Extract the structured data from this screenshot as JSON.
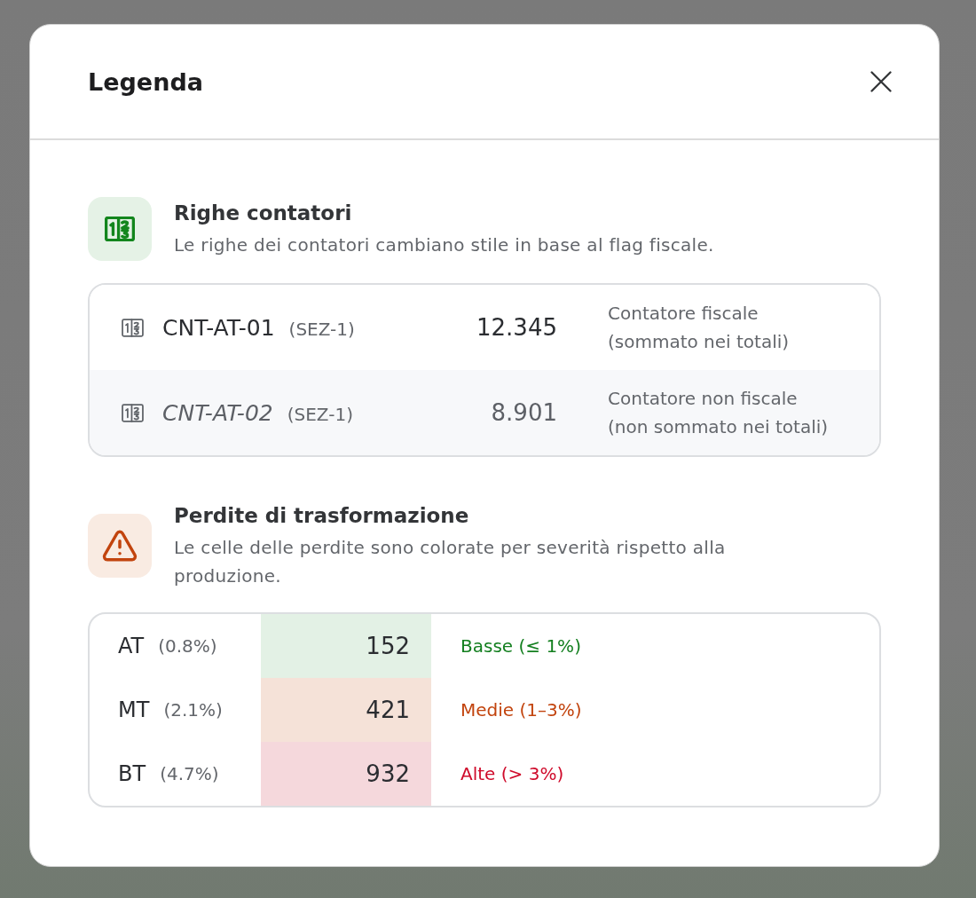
{
  "dialog": {
    "title": "Legenda"
  },
  "sections": [
    {
      "kind": "meters",
      "title": "Righe contatori",
      "description": "Le righe dei contatori cambiano stile in base al flag fiscale.",
      "rows": [
        {
          "code": "CNT-AT-01",
          "section": "(SEZ-1)",
          "reading": "12.345",
          "fiscal": true,
          "description": "Contatore fiscale",
          "note": "(sommato nei totali)"
        },
        {
          "code": "CNT-AT-02",
          "section": "(SEZ-1)",
          "reading": "8.901",
          "fiscal": false,
          "description": "Contatore non fiscale",
          "note": "(non sommato nei totali)"
        }
      ]
    },
    {
      "kind": "losses",
      "title": "Perdite di trasformazione",
      "description": "Le celle delle perdite sono colorate per severità rispetto alla produzione.",
      "rows": [
        {
          "kind": "low",
          "voltage": "AT",
          "share": "(0.8%)",
          "loss": "152",
          "severity_label": "Basse (≤ 1%)"
        },
        {
          "kind": "medium",
          "voltage": "MT",
          "share": "(2.1%)",
          "loss": "421",
          "severity_label": "Medie (1–3%)"
        },
        {
          "kind": "high",
          "voltage": "BT",
          "share": "(4.7%)",
          "loss": "932",
          "severity_label": "Alte (> 3%)"
        }
      ]
    }
  ]
}
